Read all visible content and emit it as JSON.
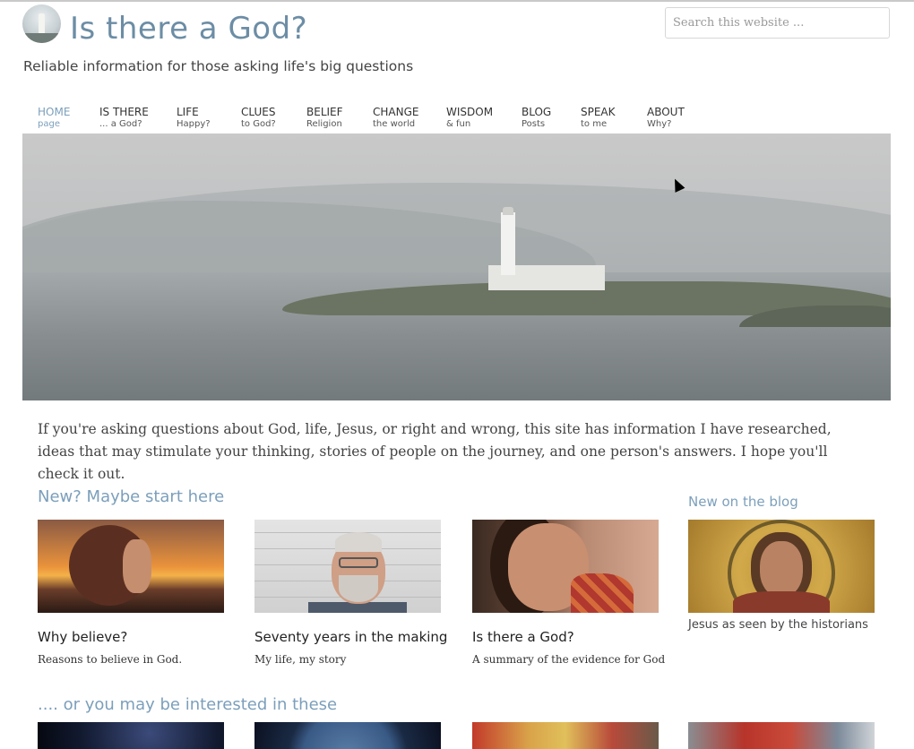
{
  "header": {
    "site_title": "Is there a God?",
    "tagline": "Reliable information for those asking life's big questions",
    "search_placeholder": "Search this website ..."
  },
  "nav": {
    "items": [
      {
        "main": "HOME",
        "sub": "page",
        "active": true
      },
      {
        "main": "IS THERE",
        "sub": "... a God?"
      },
      {
        "main": "LIFE",
        "sub": "Happy?"
      },
      {
        "main": "CLUES",
        "sub": "to God?"
      },
      {
        "main": "BELIEF",
        "sub": "Religion"
      },
      {
        "main": "CHANGE",
        "sub": "the world"
      },
      {
        "main": "WISDOM",
        "sub": "& fun"
      },
      {
        "main": "BLOG",
        "sub": "Posts"
      },
      {
        "main": "SPEAK",
        "sub": "to me"
      },
      {
        "main": "ABOUT",
        "sub": "Why?"
      }
    ]
  },
  "intro": "If you're asking questions about God, life, Jesus, or right and wrong, this site has information I have researched, ideas that may stimulate your thinking, stories of people on the journey, and one person's answers. I hope you'll check it out.",
  "start_here": {
    "heading": "New? Maybe start here",
    "cards": [
      {
        "title": "Why believe?",
        "subtitle": "Reasons to believe in God."
      },
      {
        "title": "Seventy years in the making",
        "subtitle": "My life, my story"
      },
      {
        "title": "Is there a God?",
        "subtitle": "A summary of the evidence for God"
      }
    ]
  },
  "blog": {
    "heading": "New on the blog",
    "caption": "Jesus as seen by the historians"
  },
  "more": {
    "heading": ".... or you may be interested in these"
  },
  "colors": {
    "accent": "#7c9fbb",
    "title": "#6c8da5"
  }
}
